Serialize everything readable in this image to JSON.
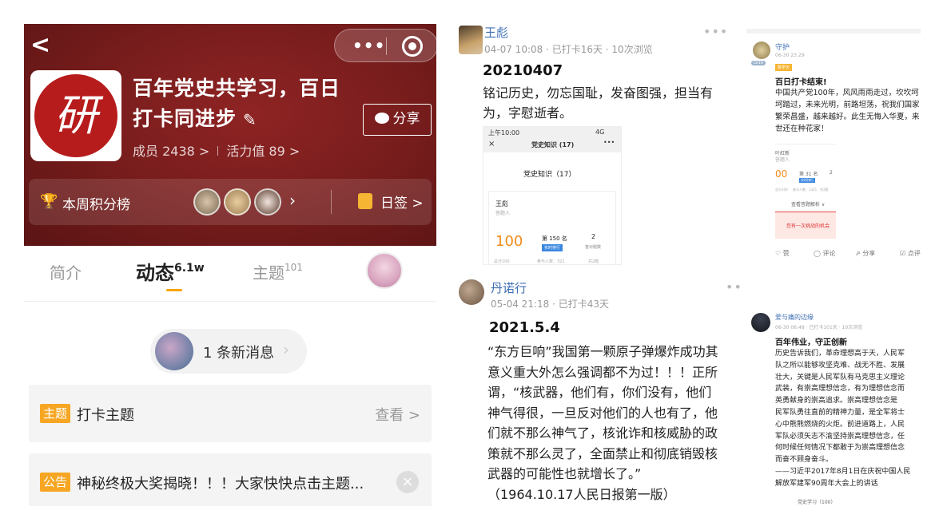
{
  "left": {
    "group_title": "百年党史共学习，百日打卡同进步",
    "stats": {
      "members": "成员 2438 >",
      "activity": "活力值 89 >"
    },
    "share_label": "分享",
    "rank": {
      "label": "本周积分榜",
      "sign_label": "日签 >"
    },
    "tabs": [
      {
        "label": "简介"
      },
      {
        "label": "动态",
        "count": "6.1w"
      },
      {
        "label": "主题",
        "count": "101"
      }
    ],
    "new_message": "1 条新消息",
    "topic_card": {
      "badge": "主题",
      "text": "打卡主题",
      "action": "查看 >"
    },
    "notice_card": {
      "badge": "公告",
      "text": "神秘终极大奖揭晓！！！大家快快点击主题..."
    }
  },
  "middle": {
    "post1": {
      "author": "王彪",
      "meta": "04-07 10:08 · 已打卡16天 · 10次浏览",
      "title": "20210407",
      "body": [
        "铭记历史，勿忘国耻，发奋图强，担当有",
        "为，字慰逝者。"
      ],
      "shot": {
        "time": "上午10:00",
        "signal": "4G",
        "nav_title": "党史知识 (17)",
        "heading": "党史知识（17）",
        "name": "王彪",
        "role": "答题人",
        "score": "100",
        "rank": "第 150 名",
        "rank_btn": "实时排行",
        "count": "2",
        "count_label": "答对题数",
        "foot": [
          "总分100",
          "参与人数：321",
          "共2题"
        ]
      }
    },
    "post2": {
      "author": "丹诺行",
      "meta": "05-04 21:18 · 已打卡43天",
      "title": "2021.5.4",
      "body": [
        "“东方巨响”我国第一颗原子弹爆炸成功其",
        "意义重大外怎么强调都不为过！！！正所",
        "谓，“核武器，他们有，你们没有，他们",
        "神气得很，一旦反对他们的人也有了，他",
        "们就不那么神气了，核讹诈和核威胁的政",
        "策就不那么灵了，全面禁止和彻底销毁核",
        "武器的可能性也就增长了。”",
        "（1964.10.17人民日报第一版）"
      ]
    }
  },
  "right": {
    "post1": {
      "author": "守护",
      "meta": "06-30 23:29",
      "level": "LV16",
      "tag": "数学天",
      "title": "百日打卡结束!",
      "body": [
        "中国共产党100年，风风雨雨走过，坎坎坷",
        "坷踏过，未来光明，前路坦荡，祝我们国家",
        "繁荣昌盛，越来越好。此生无悔入华夏，来",
        "世还在种花家！"
      ],
      "mini": {
        "name": "叶紅新",
        "role": "答题人",
        "score": "00",
        "rank": "第 31 名",
        "btn": "实时排行",
        "count": "2",
        "foot": [
          "总分100",
          "参与人数：1321",
          "共2题"
        ],
        "select": "查看答题解析 ∨",
        "retry": "您有一次挑战的机会"
      },
      "actions": [
        "赞",
        "评论",
        "分享",
        "点评"
      ]
    },
    "post2": {
      "author": "爱与痛的边缘",
      "meta": "06-30 06:48 · 已打卡101天 · 10次浏览",
      "title": "百年伟业，守正创新",
      "body": [
        "历史告诉我们，革命理想高于天，人民军",
        "队之所以能够攻坚克难、战无不胜、发展",
        "壮大，关键是人民军队有马克思主义理论",
        "武装，有崇高理想信念，有为理想信念而",
        "英勇献身的崇高追求。崇高理想信念是",
        "民军队勇往直前的精神力量，是全军将士",
        "心中熊熊燃烧的火炬。前进道路上，人民",
        "军队必须矢志不渝坚持崇高理想信念，任",
        "何时候任何情况下都敢于为崇高理想信念",
        "而奋不顾身奋斗。",
        "——习近平2017年8月1日在庆祝中国人民",
        "解放军建军90周年大会上的讲话"
      ],
      "foot": "党史学习（100）"
    }
  },
  "colors": {
    "hero": "#7a1d1d",
    "accent": "#f6a623",
    "link": "#3f6fb3"
  }
}
